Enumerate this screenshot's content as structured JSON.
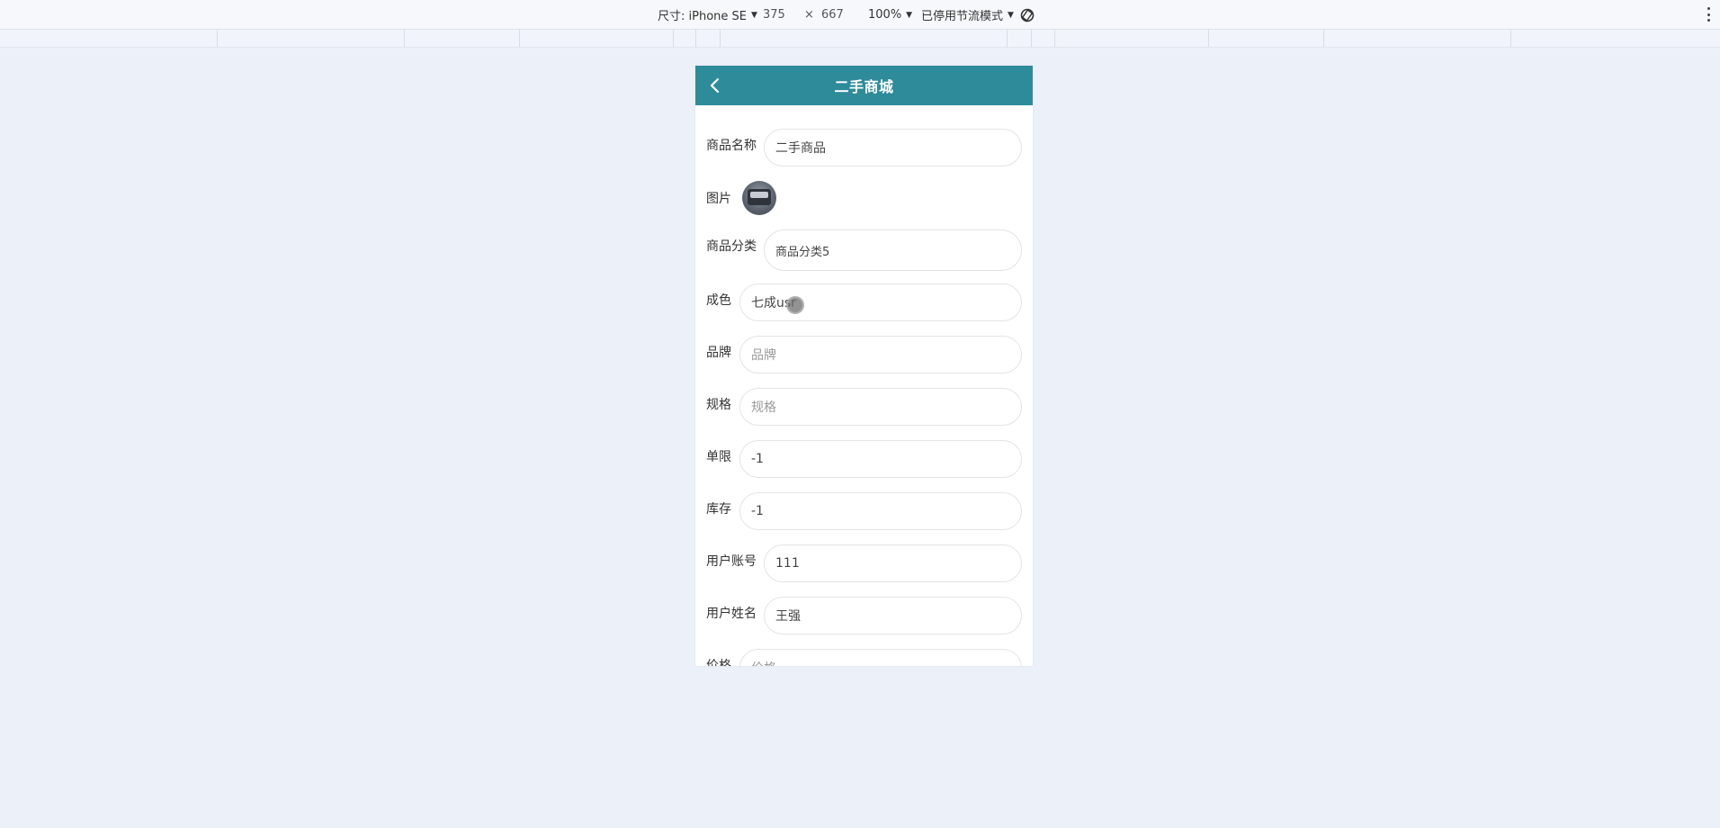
{
  "devtools": {
    "device_label": "尺寸: iPhone SE",
    "width": "375",
    "times": "×",
    "height": "667",
    "zoom": "100%",
    "throttle": "已停用节流模式"
  },
  "app": {
    "title": "二手商城",
    "header_color": "#2e8b9a"
  },
  "form": {
    "name": {
      "label": "商品名称",
      "value": "二手商品"
    },
    "image": {
      "label": "图片"
    },
    "category": {
      "label": "商品分类",
      "value": "商品分类5"
    },
    "condition": {
      "label": "成色",
      "value": "七成usr"
    },
    "brand": {
      "label": "品牌",
      "placeholder": "品牌"
    },
    "spec": {
      "label": "规格",
      "placeholder": "规格"
    },
    "limit": {
      "label": "单限",
      "value": "-1"
    },
    "stock": {
      "label": "库存",
      "value": "-1"
    },
    "account": {
      "label": "用户账号",
      "value": "111"
    },
    "username": {
      "label": "用户姓名",
      "value": "王强"
    },
    "price": {
      "label": "价格",
      "placeholder": "价格"
    }
  }
}
